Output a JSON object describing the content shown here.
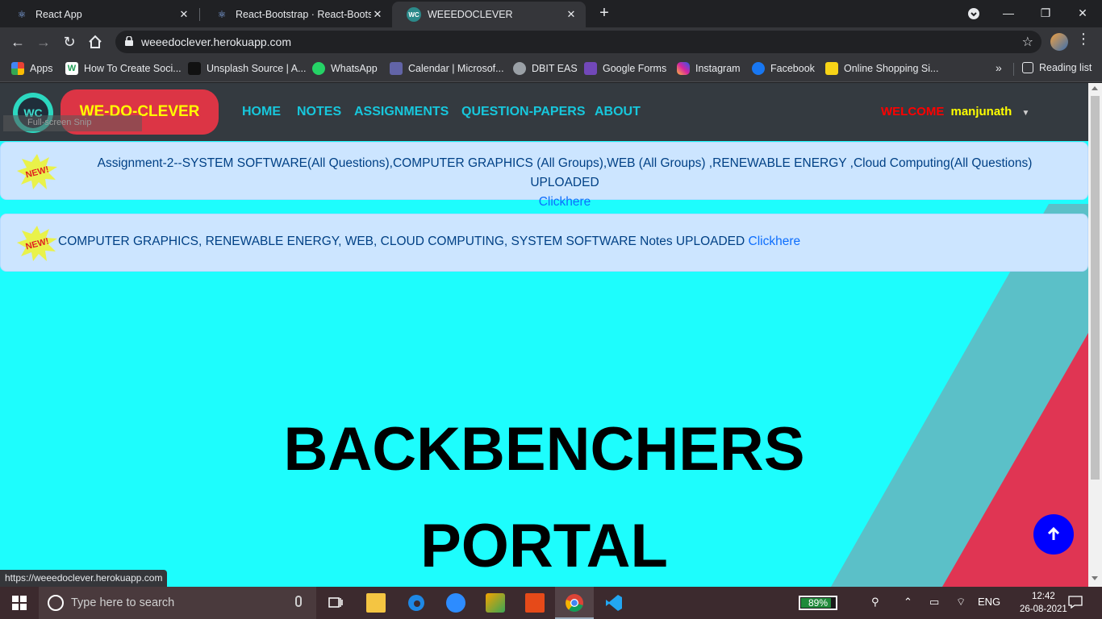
{
  "browser": {
    "tabs": [
      {
        "title": "React App",
        "close": "✕"
      },
      {
        "title": "React-Bootstrap · React-Bootstrap",
        "close": "✕"
      },
      {
        "title": "WEEEDOCLEVER",
        "close": "✕",
        "active": true
      }
    ],
    "new_tab": "+",
    "window_controls": {
      "minimize": "—",
      "maximize": "❐",
      "close": "✕"
    },
    "url": "weeedoclever.herokuapp.com",
    "bookmarks": [
      {
        "label": "Apps",
        "icon": "apps-grid-icon",
        "color": "#e94235"
      },
      {
        "label": "How To Create Soci...",
        "icon": "w-logo-icon",
        "color": "#1f9d55"
      },
      {
        "label": "Unsplash Source | A...",
        "icon": "unsplash-icon",
        "color": "#111111"
      },
      {
        "label": "WhatsApp",
        "icon": "whatsapp-icon",
        "color": "#25d366"
      },
      {
        "label": "Calendar | Microsof...",
        "icon": "teams-icon",
        "color": "#6264a7"
      },
      {
        "label": "DBIT EAS",
        "icon": "globe-icon",
        "color": "#9aa0a6"
      },
      {
        "label": "Google Forms",
        "icon": "google-forms-icon",
        "color": "#7248b9"
      },
      {
        "label": "Instagram",
        "icon": "instagram-icon",
        "color": "#d6249f"
      },
      {
        "label": "Facebook",
        "icon": "facebook-icon",
        "color": "#1877f2"
      },
      {
        "label": "Online Shopping Si...",
        "icon": "flipkart-icon",
        "color": "#f7d417"
      }
    ],
    "bookmarks_more": "»",
    "reading_list": "Reading list",
    "status_url": "https://weeedoclever.herokuapp.com"
  },
  "site": {
    "logo_text": "WC",
    "brand": "WE-DO-CLEVER",
    "snip_overlay": "Full-screen Snip",
    "nav": [
      "HOME",
      "NOTES",
      "ASSIGNMENTS",
      "QUESTION-PAPERS",
      "ABOUT"
    ],
    "welcome_label": "WELCOME",
    "user": "manjunath",
    "alerts": [
      {
        "badge": "NEW!",
        "text": "Assignment-2--SYSTEM SOFTWARE(All Questions),COMPUTER GRAPHICS (All Groups),WEB (All Groups) ,RENEWABLE ENERGY ,Cloud Computing(All Questions) UPLOADED ",
        "link": "Clickhere"
      },
      {
        "badge": "NEW!",
        "text": "COMPUTER GRAPHICS, RENEWABLE ENERGY, WEB, CLOUD COMPUTING, SYSTEM SOFTWARE Notes UPLOADED ",
        "link": "Clickhere"
      }
    ],
    "hero_line1": "BACKBENCHERS",
    "hero_line2": "PORTAL",
    "colors": {
      "background": "#1dfdfd",
      "navbar": "#343a40",
      "brand_bg": "#dc3545",
      "stripe_teal": "#5bc0c8",
      "stripe_red": "#e03553",
      "top_button": "#0000ff"
    }
  },
  "taskbar": {
    "search_placeholder": "Type here to search",
    "battery": "89%",
    "battery_level": 0.89,
    "language": "ENG",
    "time": "12:42",
    "date": "26-08-2021"
  }
}
